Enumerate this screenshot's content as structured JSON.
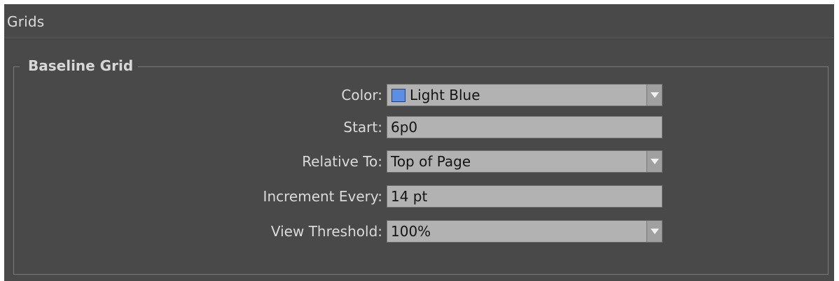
{
  "panel": {
    "title": "Grids"
  },
  "baseline_grid": {
    "group_title": "Baseline Grid",
    "color": {
      "label": "Color:",
      "value": "Light Blue",
      "swatch_color": "#5b8fe6"
    },
    "start": {
      "label": "Start:",
      "value": "6p0"
    },
    "relative_to": {
      "label": "Relative To:",
      "value": "Top of Page"
    },
    "increment_every": {
      "label": "Increment Every:",
      "value": "14 pt"
    },
    "view_threshold": {
      "label": "View Threshold:",
      "value": "100%"
    }
  },
  "icons": {
    "dropdown_arrow": "chevron-down-icon",
    "color_swatch": "color-swatch-icon"
  }
}
